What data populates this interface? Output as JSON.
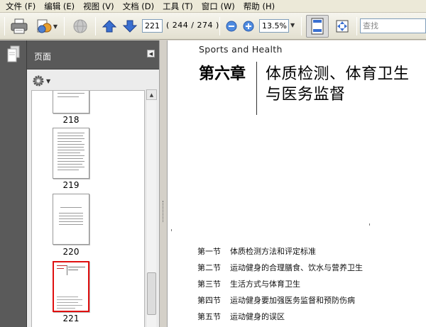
{
  "menu": [
    "文件 (F)",
    "编辑 (E)",
    "视图 (V)",
    "文档 (D)",
    "工具 (T)",
    "窗口 (W)",
    "帮助 (H)"
  ],
  "toolbar": {
    "page_number": "221",
    "page_count": "( 244 / 274 )",
    "zoom": "13.5%",
    "search_placeholder": "查找"
  },
  "sidebar": {
    "title": "页面",
    "pages": [
      {
        "label": "218",
        "selected": false
      },
      {
        "label": "219",
        "selected": false
      },
      {
        "label": "220",
        "selected": false
      },
      {
        "label": "221",
        "selected": true
      }
    ]
  },
  "document": {
    "subtitle": "Sports and Health",
    "chapter": "第六章",
    "title_line1": "体质检测、体育卫生",
    "title_line2": "与医务监督",
    "sections": [
      {
        "num": "第一节",
        "title": "体质检测方法和评定标准"
      },
      {
        "num": "第二节",
        "title": "运动健身的合理膳食、饮水与营养卫生"
      },
      {
        "num": "第三节",
        "title": "生活方式与体育卫生"
      },
      {
        "num": "第四节",
        "title": "运动健身要加强医务监督和预防伤病"
      },
      {
        "num": "第五节",
        "title": "运动健身的误区"
      }
    ]
  },
  "colors": {
    "selected_thumb_border": "#e01010",
    "nav_dark": "#595959",
    "arrow_blue": "#3a6fd0"
  }
}
